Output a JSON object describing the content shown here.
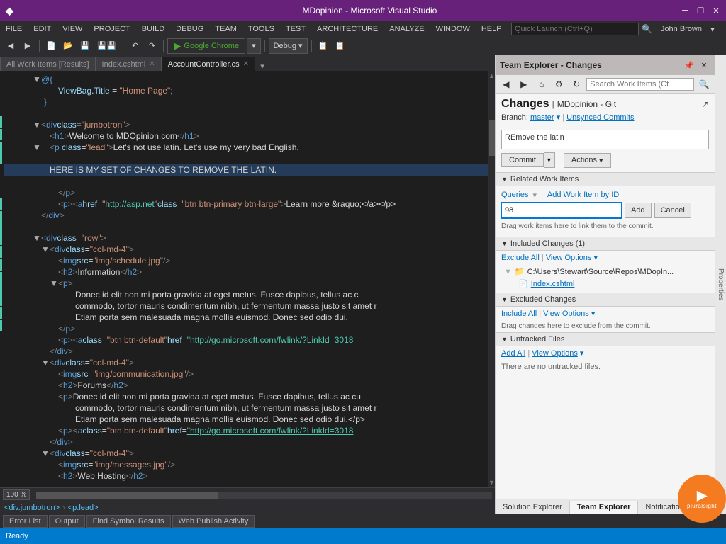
{
  "window": {
    "title": "MDopinion - Microsoft Visual Studio",
    "logo": "VS"
  },
  "titlebar": {
    "title": "MDopinion - Microsoft Visual Studio",
    "minimize_label": "─",
    "restore_label": "❐",
    "close_label": "✕"
  },
  "menu": {
    "items": [
      "FILE",
      "EDIT",
      "VIEW",
      "PROJECT",
      "BUILD",
      "DEBUG",
      "TEAM",
      "TOOLS",
      "TEST",
      "ARCHITECTURE",
      "ANALYZE",
      "WINDOW",
      "HELP"
    ]
  },
  "toolbar": {
    "run_label": "Google Chrome",
    "config_label": "Debug",
    "search_placeholder": "Quick Launch (Ctrl+Q)",
    "user_name": "John Brown"
  },
  "editor": {
    "tabs": [
      {
        "label": "All Work Items [Results]",
        "active": false,
        "closeable": false
      },
      {
        "label": "Index.cshtml",
        "active": false,
        "closeable": true
      },
      {
        "label": "AccountController.cs",
        "active": true,
        "closeable": true
      }
    ],
    "zoom": "100 %",
    "breadcrumbs": [
      "<div.jumbotron>",
      "<p.lead>"
    ],
    "lines": [
      {
        "num": "",
        "indent": "    ",
        "content": "@{",
        "type": "plain"
      },
      {
        "num": "",
        "indent": "        ",
        "content": "ViewBag.Title = \"Home Page\";",
        "type": "plain"
      },
      {
        "num": "",
        "indent": "    ",
        "content": "}",
        "type": "plain"
      },
      {
        "num": "",
        "indent": "",
        "content": "",
        "type": "blank"
      },
      {
        "num": "",
        "indent": "",
        "content": "<div class=\"jumbotron\">",
        "type": "html"
      },
      {
        "num": "",
        "indent": "    ",
        "content": "<h1>Welcome to MDOpinion.com</h1>",
        "type": "html"
      },
      {
        "num": "",
        "indent": "    ",
        "content": "<p class=\"lead\">Let's not use latin. Let's use my very bad English.",
        "type": "html"
      },
      {
        "num": "",
        "indent": "",
        "content": "",
        "type": "blank"
      },
      {
        "num": "",
        "indent": "    ",
        "content": "HERE IS MY SET OF CHANGES TO REMOVE THE LATIN.",
        "type": "plain"
      },
      {
        "num": "",
        "indent": "",
        "content": "",
        "type": "blank"
      },
      {
        "num": "",
        "indent": "        ",
        "content": "</p>",
        "type": "html"
      },
      {
        "num": "",
        "indent": "        ",
        "content": "<p><a href=\"http://asp.net\" class=\"btn btn-primary btn-large\">Learn more &raquo;</a>",
        "type": "html"
      },
      {
        "num": "",
        "indent": "    ",
        "content": "</div>",
        "type": "html"
      },
      {
        "num": "",
        "indent": "",
        "content": "",
        "type": "blank"
      },
      {
        "num": "",
        "indent": "",
        "content": "<div class=\"row\">",
        "type": "html"
      },
      {
        "num": "",
        "indent": "    ",
        "content": "<div class=\"col-md-4\">",
        "type": "html"
      },
      {
        "num": "",
        "indent": "        ",
        "content": "<img src=\"img/schedule.jpg\" />",
        "type": "html"
      },
      {
        "num": "",
        "indent": "        ",
        "content": "<h2>Information</h2>",
        "type": "html"
      },
      {
        "num": "",
        "indent": "        ",
        "content": "<p>",
        "type": "html"
      },
      {
        "num": "",
        "indent": "            ",
        "content": "Donec id elit non mi porta gravida at eget metus. Fusce dapibus, tellus ac c",
        "type": "plain"
      },
      {
        "num": "",
        "indent": "            ",
        "content": "commodo, tortor mauris condimentum nibh, ut fermentum massa justo sit amet r",
        "type": "plain"
      },
      {
        "num": "",
        "indent": "            ",
        "content": "Etiam porta sem malesuada magna mollis euismod. Donec sed odio dui.",
        "type": "plain"
      },
      {
        "num": "",
        "indent": "        ",
        "content": "</p>",
        "type": "html"
      },
      {
        "num": "",
        "indent": "        ",
        "content": "<p><a class=\"btn btn-default\" href=\"http://go.microsoft.com/fwlink/?LinkId=3018",
        "type": "html"
      },
      {
        "num": "",
        "indent": "    ",
        "content": "</div>",
        "type": "html"
      },
      {
        "num": "",
        "indent": "    ",
        "content": "<div class=\"col-md-4\">",
        "type": "html"
      },
      {
        "num": "",
        "indent": "        ",
        "content": "<img src=\"img/communication.jpg\" />",
        "type": "html"
      },
      {
        "num": "",
        "indent": "        ",
        "content": "<h2>Forums</h2>",
        "type": "html"
      },
      {
        "num": "",
        "indent": "        ",
        "content": "<p>Donec id elit non mi porta gravida at eget metus. Fusce dapibus, tellus ac cu",
        "type": "plain"
      },
      {
        "num": "",
        "indent": "            ",
        "content": "commodo, tortor mauris condimentum nibh, ut fermentum massa justo sit amet r",
        "type": "plain"
      },
      {
        "num": "",
        "indent": "            ",
        "content": "Etiam porta sem malesuada magna mollis euismod. Donec sed odio dui.</p>",
        "type": "plain"
      },
      {
        "num": "",
        "indent": "        ",
        "content": "<p><a class=\"btn btn-default\" href=\"http://go.microsoft.com/fwlink/?LinkId=3018",
        "type": "html"
      },
      {
        "num": "",
        "indent": "    ",
        "content": "</div>",
        "type": "html"
      },
      {
        "num": "",
        "indent": "    ",
        "content": "<div class=\"col-md-4\">",
        "type": "html"
      },
      {
        "num": "",
        "indent": "        ",
        "content": "<img src=\"img/messages.jpg\" />",
        "type": "html"
      },
      {
        "num": "",
        "indent": "        ",
        "content": "<h2>Web Hosting</h2>",
        "type": "html"
      }
    ]
  },
  "team_explorer": {
    "title": "Team Explorer - Changes",
    "section_title": "Changes",
    "project": "MDopinion - Git",
    "branch": "master",
    "branch_dropdown": "▾",
    "unsynced_commits": "Unsynced Commits",
    "commit_message": "REmove the latin",
    "commit_btn": "Commit",
    "actions_btn": "Actions",
    "search_placeholder": "Search Work Items (Ct",
    "related_work_items_title": "Related Work Items",
    "queries_label": "Queries",
    "add_by_id_label": "Add Work Item by ID",
    "work_item_id_value": "98",
    "add_btn": "Add",
    "cancel_btn": "Cancel",
    "drag_hint": "Drag work items here to link them to the commit.",
    "included_changes_title": "Included Changes (1)",
    "exclude_all_label": "Exclude All",
    "view_options_label1": "View Options",
    "file_path": "C:\\Users\\Stewart\\Source\\Repos\\MDopIn...",
    "file_name": "Index.cshtml",
    "excluded_changes_title": "Excluded Changes",
    "include_all_label": "Include All",
    "view_options_label2": "View Options",
    "excluded_drag_hint": "Drag changes here to exclude from the commit.",
    "untracked_files_title": "Untracked Files",
    "add_all_label": "Add All",
    "view_options_label3": "View Options",
    "no_untracked": "There are no untracked files.",
    "bottom_tabs": [
      "Solution Explorer",
      "Team Explorer",
      "Notifications"
    ]
  },
  "bottom_tabs": [
    "Error List",
    "Output",
    "Find Symbol Results",
    "Web Publish Activity"
  ],
  "status_bar": {
    "status_text": "Ready"
  }
}
